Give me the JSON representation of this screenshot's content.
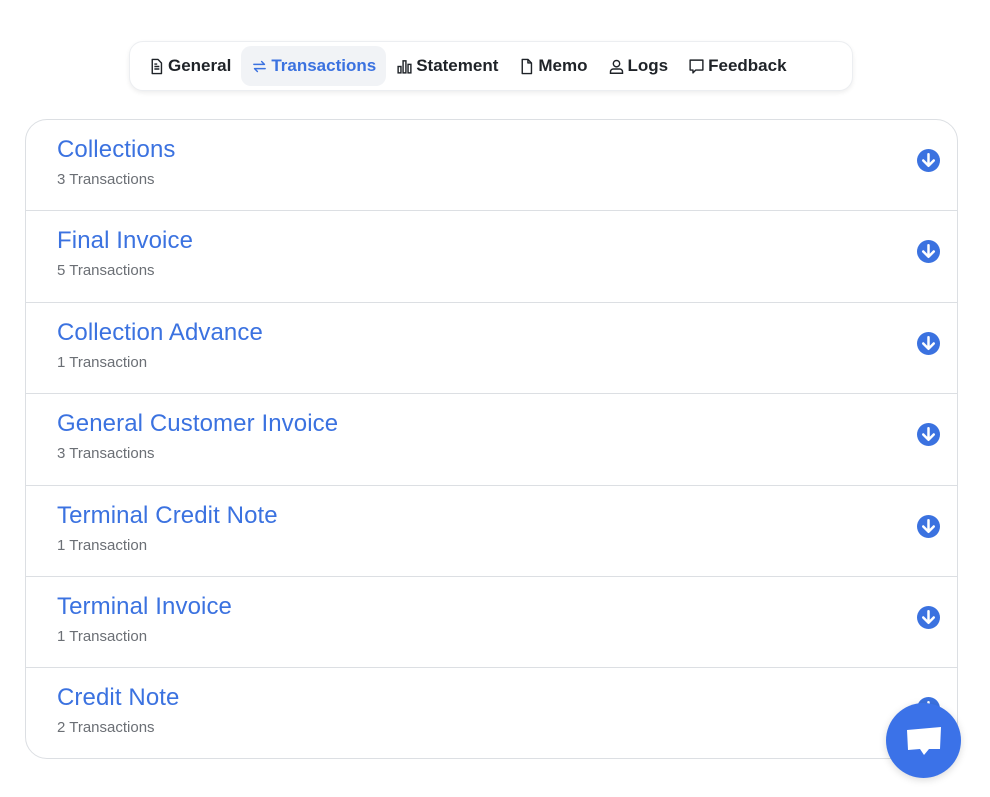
{
  "tabs": [
    {
      "id": "general",
      "label": "General",
      "icon": "document-icon",
      "active": false
    },
    {
      "id": "transactions",
      "label": "Transactions",
      "icon": "arrows-exchange-icon",
      "active": true
    },
    {
      "id": "statement",
      "label": "Statement",
      "icon": "bar-chart-icon",
      "active": false
    },
    {
      "id": "memo",
      "label": "Memo",
      "icon": "file-icon",
      "active": false
    },
    {
      "id": "logs",
      "label": "Logs",
      "icon": "user-icon",
      "active": false
    },
    {
      "id": "feedback",
      "label": "Feedback",
      "icon": "chat-bubble-icon",
      "active": false
    }
  ],
  "groups": [
    {
      "title": "Collections",
      "count_label": "3 Transactions"
    },
    {
      "title": "Final Invoice",
      "count_label": "5 Transactions"
    },
    {
      "title": "Collection Advance",
      "count_label": "1 Transaction"
    },
    {
      "title": "General Customer Invoice",
      "count_label": "3 Transactions"
    },
    {
      "title": "Terminal Credit Note",
      "count_label": "1 Transaction"
    },
    {
      "title": "Terminal Invoice",
      "count_label": "1 Transaction"
    },
    {
      "title": "Credit Note",
      "count_label": "2 Transactions"
    }
  ],
  "colors": {
    "accent": "#3b72e0",
    "active_tab_bg": "#f1f3f6",
    "chat_button": "#3b72e8"
  },
  "chat_button": {
    "icon": "chat-icon"
  }
}
